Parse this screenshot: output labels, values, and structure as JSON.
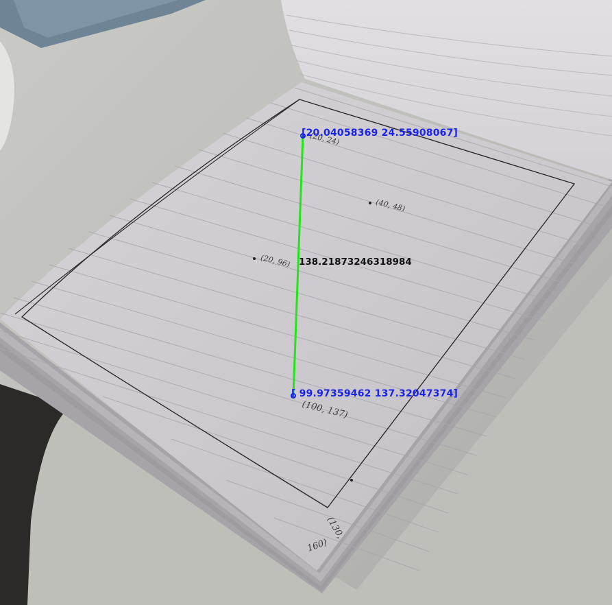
{
  "overlay": {
    "start_point": "[20.04058369  24.55908067]",
    "end_point": "[ 99.97359462 137.32047374]",
    "distance": "138.21873246318984",
    "line_color": "#22e51a",
    "label_color": "#1a22ee"
  },
  "handwritten": {
    "top_corner": "(20, 24)",
    "point_a": "(40, 48)",
    "point_b": "(20, 96)",
    "point_c": "(100, 137)",
    "corner_a": "(130,",
    "corner_b": "160)"
  }
}
